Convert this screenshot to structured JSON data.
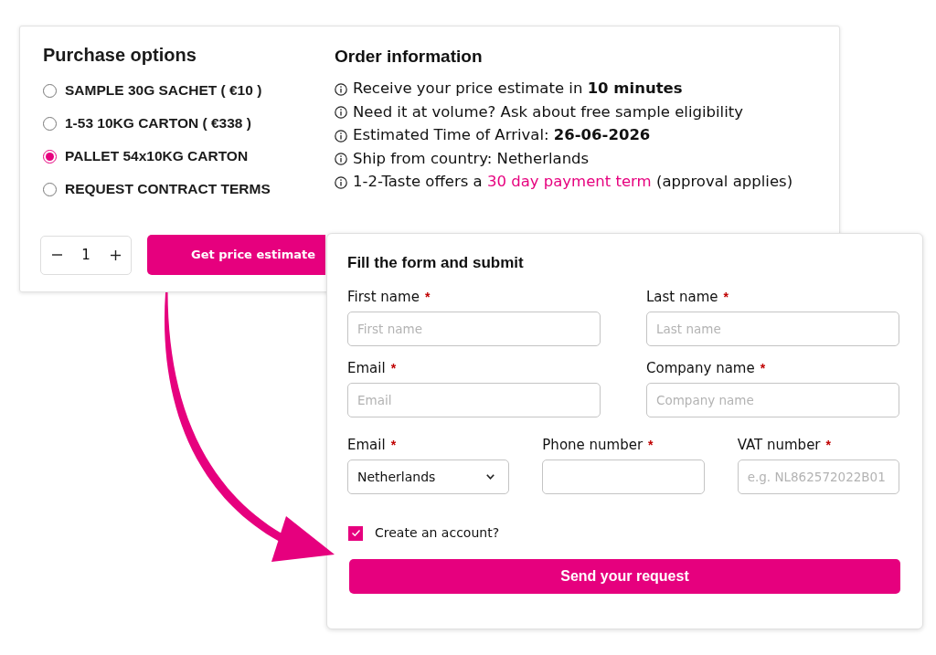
{
  "purchase_options": {
    "title": "Purchase options",
    "options": [
      {
        "label": "SAMPLE 30G SACHET ( €10 )",
        "selected": false
      },
      {
        "label": "1-53 10KG CARTON ( €338 )",
        "selected": false
      },
      {
        "label": "PALLET 54x10KG CARTON",
        "selected": true
      },
      {
        "label": "REQUEST CONTRACT TERMS",
        "selected": false
      }
    ],
    "quantity": "1",
    "estimate_button": "Get price estimate"
  },
  "order_information": {
    "title": "Order information",
    "items": [
      {
        "text": "Receive your price estimate in **10 minutes**"
      },
      {
        "text": "Need it at volume? Ask about free sample eligibility"
      },
      {
        "text": "Estimated Time of Arrival: **26-06-2026**"
      },
      {
        "text": "Ship from country: Netherlands"
      },
      {
        "text": "1-2-Taste offers a",
        "link": "30 day payment term",
        "text_after": "(approval applies)"
      }
    ]
  },
  "form": {
    "title": "Fill the form and submit",
    "rows": [
      [
        {
          "kind": "text",
          "label": "First name",
          "required_mark": "*",
          "placeholder": "First name"
        },
        {
          "kind": "text",
          "label": "Last name",
          "required_mark": "*",
          "placeholder": "Last name"
        }
      ],
      [
        {
          "kind": "text",
          "label": "Email",
          "required_mark": "*",
          "placeholder": "Email"
        },
        {
          "kind": "text",
          "label": "Company name",
          "required_mark": "*",
          "placeholder": "Company name"
        }
      ],
      [
        {
          "kind": "select",
          "label": "Email",
          "required_mark": "*",
          "value": "Netherlands"
        },
        {
          "kind": "text",
          "label": "Phone number",
          "required_mark": "*"
        },
        {
          "kind": "text",
          "label": "VAT number",
          "required_mark": "*",
          "placeholder": "e.g. NL862572022B01"
        }
      ]
    ],
    "create_account": {
      "label": "Create an account?",
      "checked": true
    },
    "submit_button": "Send your request"
  }
}
